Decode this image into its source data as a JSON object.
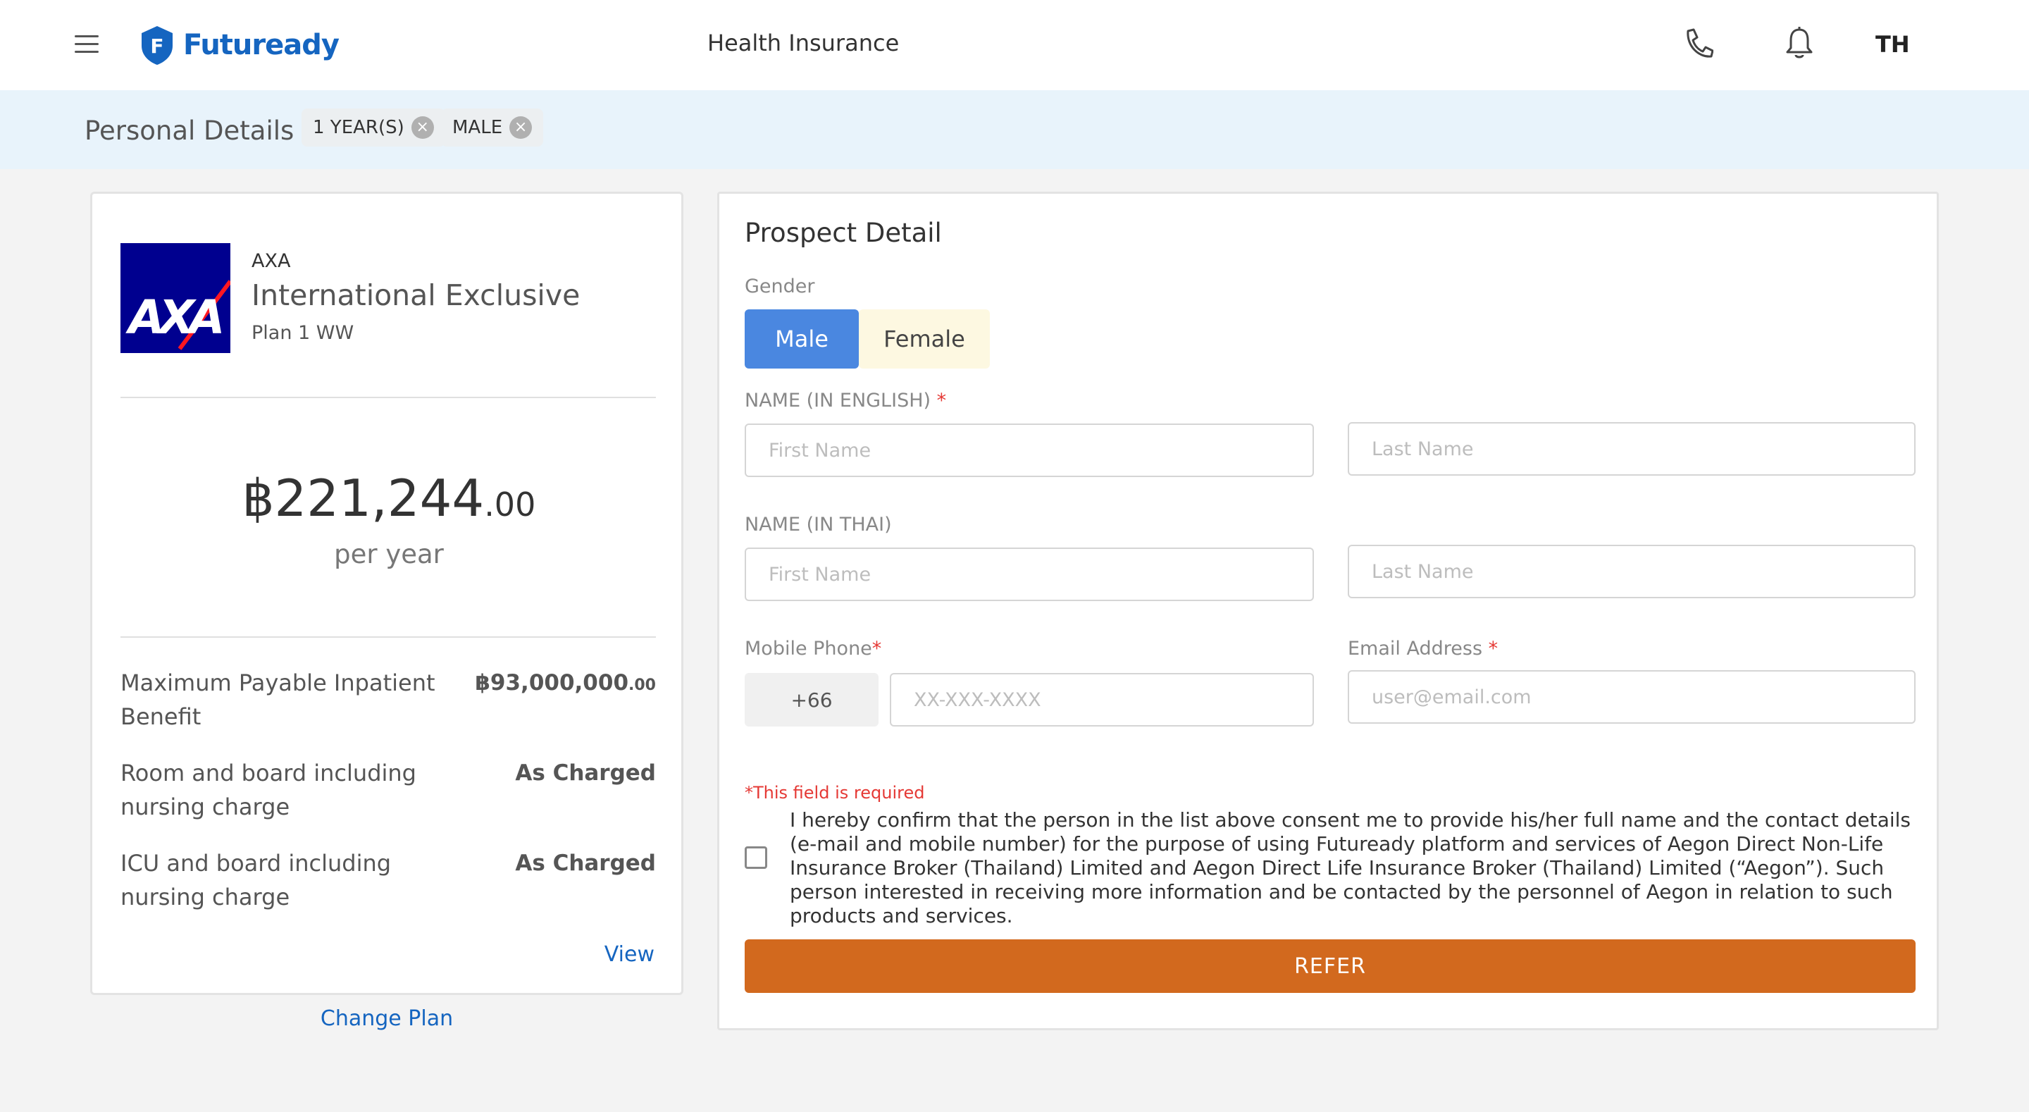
{
  "header": {
    "brand": "Futuready",
    "title": "Health Insurance",
    "lang": "TH",
    "brand_color": "#1565c0"
  },
  "filters": {
    "title": "Personal Details",
    "chips": [
      {
        "label": "1 YEAR(S)"
      },
      {
        "label": "MALE"
      }
    ]
  },
  "plan": {
    "insurer": "AXA",
    "logo_text": "AXA",
    "name": "International Exclusive",
    "sub": "Plan 1 WW",
    "price_main": "฿221,244",
    "price_cents": ".00",
    "period": "per year",
    "benefits": [
      {
        "label": "Maximum Payable Inpatient Benefit",
        "value": "฿93,000,000",
        "value_cents": ".00"
      },
      {
        "label": "Room and board including nursing charge",
        "value": "As Charged",
        "value_cents": ""
      },
      {
        "label": "ICU and board including nursing charge",
        "value": "As Charged",
        "value_cents": ""
      }
    ],
    "view_label": "View",
    "change_plan_label": "Change Plan"
  },
  "prospect": {
    "title": "Prospect Detail",
    "gender_label": "Gender",
    "gender_options": [
      "Male",
      "Female"
    ],
    "selected_gender": "Male",
    "name_en_label": "NAME (IN ENGLISH)",
    "name_th_label": "NAME (IN THAI)",
    "required_mark": "*",
    "first_name_placeholder": "First Name",
    "last_name_placeholder": "Last Name",
    "mobile_label": "Mobile Phone",
    "phone_prefix": "+66",
    "phone_placeholder": "XX-XXX-XXXX",
    "email_label": "Email Address",
    "email_placeholder": "user@email.com",
    "error_text": "*This field is required",
    "consent_text": "I hereby confirm that the person in the list above consent me to provide his/her full name and the contact details (e-mail and mobile number) for the purpose of using Futuready platform and services of Aegon Direct Non-Life Insurance Broker (Thailand) Limited and Aegon Direct Life Insurance Broker (Thailand) Limited (“Aegon”). Such person interested in receiving more information and be contacted by the personnel of Aegon in relation to such products and services.",
    "consent_checked": false,
    "refer_label": "REFER",
    "refer_color": "#d2691e"
  }
}
